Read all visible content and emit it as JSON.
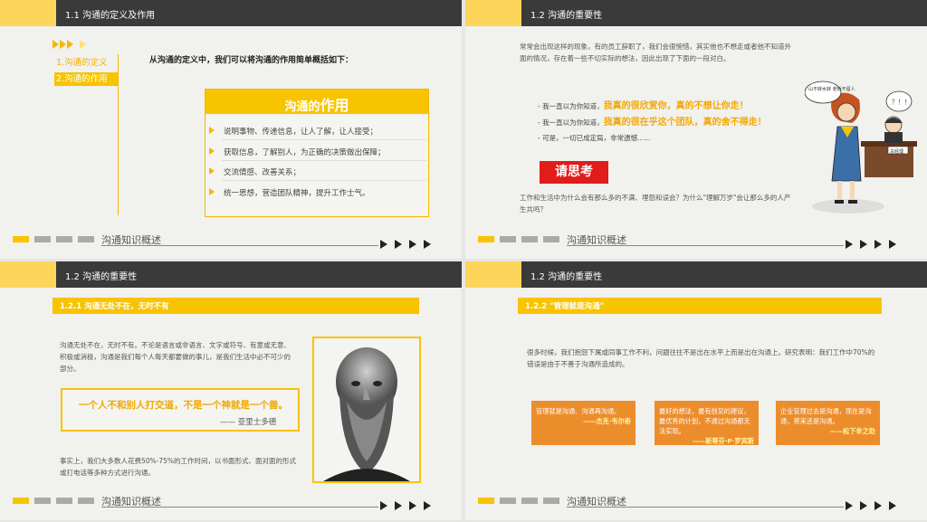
{
  "colors": {
    "accent": "#f8c300",
    "header": "#3a3a3a",
    "red": "#e21b1b",
    "orange": "#ec8d2c",
    "gray": "#aaaaaa"
  },
  "footer": {
    "label": "沟通知识概述"
  },
  "slide1": {
    "header": "1.1 沟通的定义及作用",
    "nav": [
      "1.沟通的定义",
      "2.沟通的作用"
    ],
    "intro": "从沟通的定义中，我们可以将沟通的作用简单概括如下：",
    "box_title_prefix": "沟通的",
    "box_title_suffix": "作用",
    "items": [
      "说明事物、传递信息，让人了解，让人接受；",
      "获取信息，了解别人，为正确的决策做出保障；",
      "交流情感、改善关系；",
      "统一思想，营造团队精神，提升工作士气。"
    ]
  },
  "slide2": {
    "header": "1.2 沟通的重要性",
    "para1": "常常会出现这样的现象，有的员工辞职了，我们会很惋惜，其实他也不想走或者他不知道外面的情况，存在着一些不切实际的想法，因此出现了下面的一段对白。",
    "lines": [
      {
        "prefix": "- 我一直以为你知道，",
        "highlight": "我真的很欣赏你，真的不想让你走！"
      },
      {
        "prefix": "- 我一直以为你知道，",
        "highlight": "我真的很在乎这个团队，真的舍不得走！"
      },
      {
        "prefix": "- 可是，一切已成定局，非常遗憾......",
        "highlight": ""
      }
    ],
    "think": "请思考",
    "para2": "工作和生活中为什么会有那么多的不满、埋怨和误会？为什么\"理解万岁\"会让那么多的人产生共鸣？",
    "bubble1": "山不转水转 老板不留人",
    "bubble2": "？！！",
    "desk_sign": "总经理"
  },
  "slide3": {
    "header": "1.2 沟通的重要性",
    "subheader": "1.2.1  沟通无处不在，无时不有",
    "para1": "沟通无处不在，无时不有。不论是语言或非语言、文字或符号、有意或无意、积极或消极，沟通是我们每个人每天都要做的事儿，是我们生活中必不可少的部分。",
    "quote": "一个人不和别人打交道，不是一个神就是一个兽。",
    "author": "—— 亚里士多德",
    "para2": "事实上，我们大多数人花费50%-75%的工作时间，以书面形式、面对面的形式或打电话等多种方式进行沟通。"
  },
  "slide4": {
    "header": "1.2 沟通的重要性",
    "subheader": "1.2.2  \"管理就是沟通\"",
    "para": "很多时候，我们抱怨下属或同事工作不利，问题往往不是出在水平上而是出在沟通上。研究表明：我们工作中70%的错误是由于不善于沟通所造成的。",
    "boxes": [
      {
        "text": "管理就是沟通、沟通再沟通。",
        "author": "——杰克·韦尔奇"
      },
      {
        "text": "最好的想法，最有创见的建议，最优秀的计划，不通过沟通都无法实现。",
        "author": "——斯蒂芬·P·罗宾斯"
      },
      {
        "text": "企业管理过去是沟通，现在是沟通，将来还是沟通。",
        "author": "——松下幸之助"
      }
    ]
  }
}
